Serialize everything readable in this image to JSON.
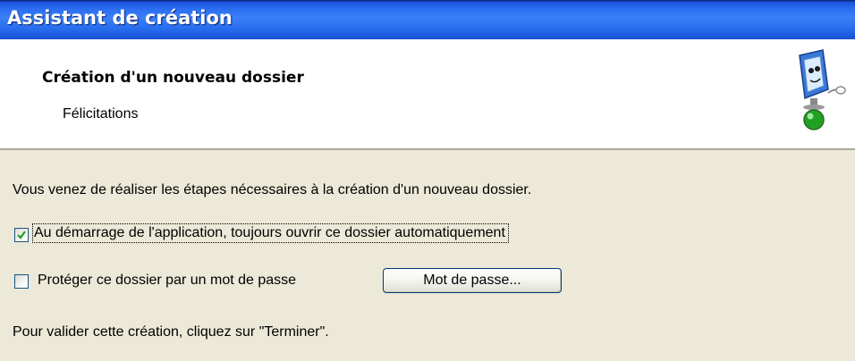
{
  "window": {
    "title": "Assistant de création"
  },
  "header": {
    "title": "Création d'un nouveau dossier",
    "subtitle": "Félicitations",
    "icon": "wizard-computer-icon"
  },
  "content": {
    "intro_text": "Vous venez de réaliser les étapes nécessaires à la création d'un nouveau dossier.",
    "auto_open": {
      "label": "Au démarrage de l'application, toujours ouvrir ce dossier automatiquement",
      "checked": true
    },
    "protect": {
      "label": "Protéger ce dossier par un mot de passe",
      "checked": false
    },
    "password_button_label": "Mot de passe...",
    "final_text": "Pour valider cette création, cliquez sur \"Terminer\"."
  },
  "colors": {
    "titlebar_blue": "#2a6cf0",
    "dialog_background": "#ece9d8",
    "check_green": "#21a121"
  }
}
